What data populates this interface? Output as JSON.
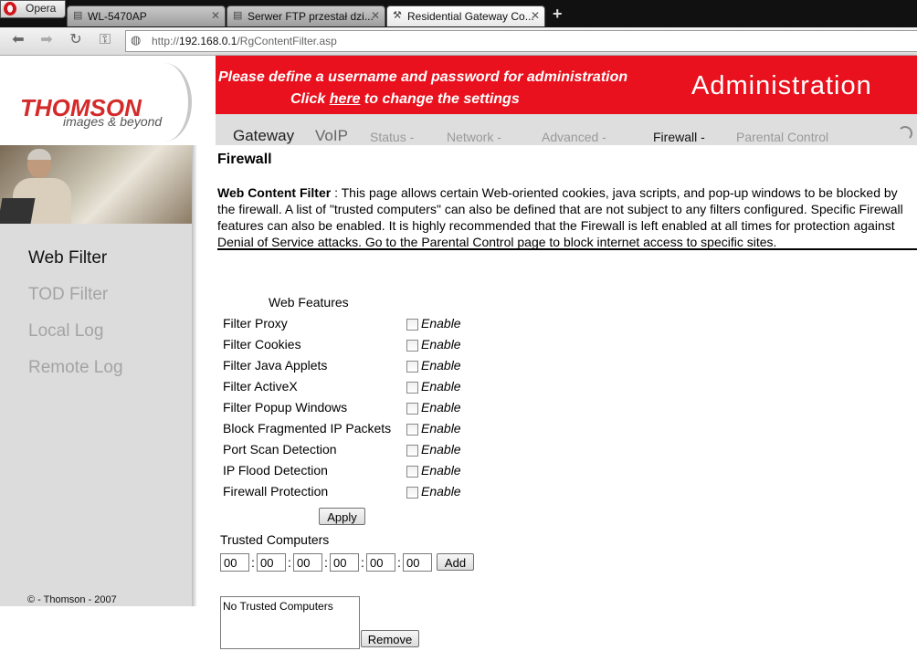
{
  "browser": {
    "opera_label": "Opera",
    "tabs": [
      {
        "label": "WL-5470AP",
        "icon": "page-icon"
      },
      {
        "label": "Serwer FTP przestał dzi...",
        "icon": "page-icon"
      },
      {
        "label": "Residential Gateway Co...",
        "icon": "tools-icon"
      }
    ],
    "url_prefix": "http://",
    "url_host": "192.168.0.1",
    "url_path": "/RgContentFilter.asp"
  },
  "header": {
    "logo_text": "THOMSON",
    "logo_tagline": "images & beyond",
    "banner_line1": "Please define a username and password for administration",
    "banner_line2_before": "Click ",
    "banner_line2_link": "here",
    "banner_line2_after": " to change the settings",
    "title": "Administration",
    "banner_color": "#e8111d"
  },
  "menu": [
    {
      "label": "Gateway"
    },
    {
      "label": "VoIP"
    },
    {
      "label": "Status -"
    },
    {
      "label": "Network -"
    },
    {
      "label": "Advanced -"
    },
    {
      "label": "Firewall -"
    },
    {
      "label": "Parental Control"
    }
  ],
  "sidebar": {
    "items": [
      {
        "label": "Web Filter",
        "active": true
      },
      {
        "label": "TOD Filter",
        "active": false
      },
      {
        "label": "Local Log",
        "active": false
      },
      {
        "label": "Remote Log",
        "active": false
      }
    ],
    "copyright": "© - Thomson - 2007"
  },
  "main": {
    "title": "Firewall",
    "desc_heading": "Web Content Filter",
    "desc_sep": " : ",
    "desc_text": " This page allows certain Web-oriented cookies, java scripts, and pop-up windows to be blocked by the firewall. A list of \"trusted computers\" can also be defined that are not subject to any filters configured. Specific Firewall features can also be enabled. It is highly recommended that the Firewall is left enabled at all times for protection against Denial of Service attacks. Go to the Parental Control page to block internet access to specific sites.",
    "features_title": "Web Features",
    "enable_label": "Enable",
    "features": [
      {
        "label": "Filter Proxy",
        "checked": false
      },
      {
        "label": "Filter Cookies",
        "checked": false
      },
      {
        "label": "Filter Java Applets",
        "checked": false
      },
      {
        "label": "Filter ActiveX",
        "checked": false
      },
      {
        "label": "Filter Popup Windows",
        "checked": false
      },
      {
        "label": "Block Fragmented IP Packets",
        "checked": false
      },
      {
        "label": "Port Scan Detection",
        "checked": false
      },
      {
        "label": "IP Flood Detection",
        "checked": false
      },
      {
        "label": "Firewall Protection",
        "checked": false
      }
    ],
    "apply_label": "Apply",
    "trusted_title": "Trusted Computers",
    "mac_octets": [
      "00",
      "00",
      "00",
      "00",
      "00",
      "00"
    ],
    "mac_separator": ":",
    "add_label": "Add",
    "trusted_list_text": "No Trusted Computers",
    "remove_label": "Remove"
  }
}
